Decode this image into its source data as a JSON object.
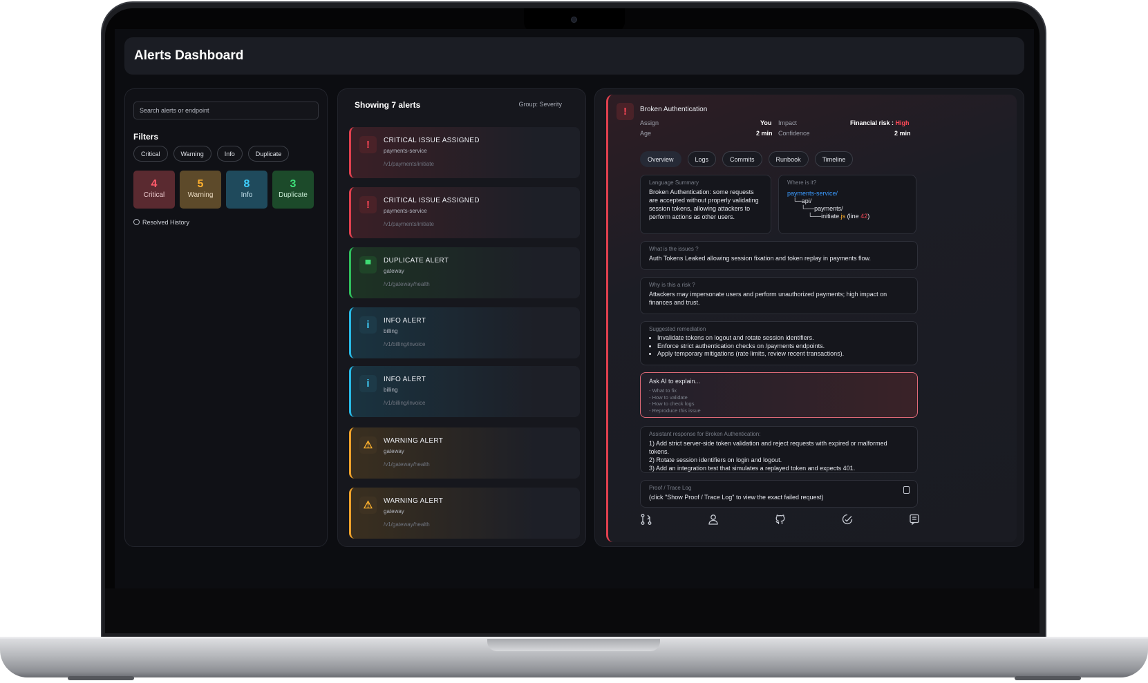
{
  "app": {
    "title": "Alerts Dashboard"
  },
  "sidebar": {
    "search_placeholder": "Search alerts or endpoint",
    "filters_title": "Filters",
    "chips": [
      "Critical",
      "Warning",
      "Info",
      "Duplicate"
    ],
    "stats": [
      {
        "count": "4",
        "label": "Critical"
      },
      {
        "count": "5",
        "label": "Warning"
      },
      {
        "count": "8",
        "label": "Info"
      },
      {
        "count": "3",
        "label": "Duplicate"
      }
    ],
    "resolved_label": "Resolved History"
  },
  "list": {
    "title": "Showing 7 alerts",
    "group": "Group: Severity",
    "alerts": [
      {
        "title": "CRITICAL ISSUE ASSIGNED",
        "service": "payments-service",
        "endpoint": "/v1/payments/initiate",
        "icon": "!"
      },
      {
        "title": "CRITICAL ISSUE ASSIGNED",
        "service": "payments-service",
        "endpoint": "/v1/payments/initiate",
        "icon": "!"
      },
      {
        "title": "DUPLICATE ALERT",
        "service": "gateway",
        "endpoint": "/v1/gateway/health",
        "icon": "▀"
      },
      {
        "title": "INFO ALERT",
        "service": "billing",
        "endpoint": "/v1/billing/invoice",
        "icon": "i"
      },
      {
        "title": "INFO ALERT",
        "service": "billing",
        "endpoint": "/v1/billing/invoice",
        "icon": "i"
      },
      {
        "title": "WARNING ALERT",
        "service": "gateway",
        "endpoint": "/v1/gateway/health",
        "icon": "⚠"
      },
      {
        "title": "WARNING ALERT",
        "service": "gateway",
        "endpoint": "/v1/gateway/health",
        "icon": "⚠"
      }
    ]
  },
  "detail": {
    "icon": "!",
    "title": "Broken Authentication",
    "assign_label": "Assign",
    "assign_value": "You",
    "age_label": "Age",
    "age_value": "2 min",
    "impact_label": "Impact",
    "impact_value": "Financial risk :",
    "impact_level": "High",
    "confidence_label": "Confidence",
    "confidence_value": "2 min",
    "tabs": [
      "Overview",
      "Logs",
      "Commits",
      "Runbook",
      "Timeline"
    ],
    "language_summary": {
      "caption": "Language Summary",
      "text": "Broken Authentication: some requests are accepted without properly validating session tokens, allowing attackers to perform actions as other users."
    },
    "where": {
      "caption": "Where is it?",
      "root": "payments-service/",
      "l1": "api/",
      "l2": "payments/",
      "file": "initiate",
      "ext": ".js",
      "line_prefix": "(line",
      "line": "42",
      "line_suffix": ")"
    },
    "issue": {
      "caption": "What is the issues ?",
      "text": "Auth Tokens Leaked allowing session fixation and token replay in payments flow."
    },
    "risk": {
      "caption": "Why is this a risk ?",
      "text": "Attackers may impersonate users and perform unauthorized payments; high impact on finances and trust."
    },
    "remediation": {
      "caption": "Suggested remediation",
      "items": [
        "Invalidate tokens on logout and rotate session identifiers.",
        "Enforce strict authentication checks on /payments endpoints.",
        "Apply temporary mitigations (rate limits, review recent transactions)."
      ]
    },
    "ask": {
      "placeholder": "Ask AI to explain...",
      "suggestions": [
        "- What to fix",
        "- How to validate",
        "- How to check logs",
        "- Reproduce this issue"
      ]
    },
    "assistant": {
      "caption": "Assistant response for Broken Authentication:",
      "lines": [
        "1) Add strict server-side token validation and reject requests with expired or malformed tokens.",
        "2) Rotate session identifiers on login and logout.",
        "3) Add an integration test that simulates a replayed token and expects 401."
      ]
    },
    "proof": {
      "caption": "Proof / Trace Log",
      "text": "(click \"Show Proof / Trace Log\" to view the exact failed request)"
    },
    "bottom_icons": [
      "merge-icon",
      "user-icon",
      "github-icon",
      "check-gauge-icon",
      "notes-icon"
    ]
  },
  "colors": {
    "critical": "#e0404e",
    "warning": "#eea12a",
    "info": "#28b9e6",
    "duplicate": "#2fbf5c",
    "link": "#3a9bff"
  }
}
